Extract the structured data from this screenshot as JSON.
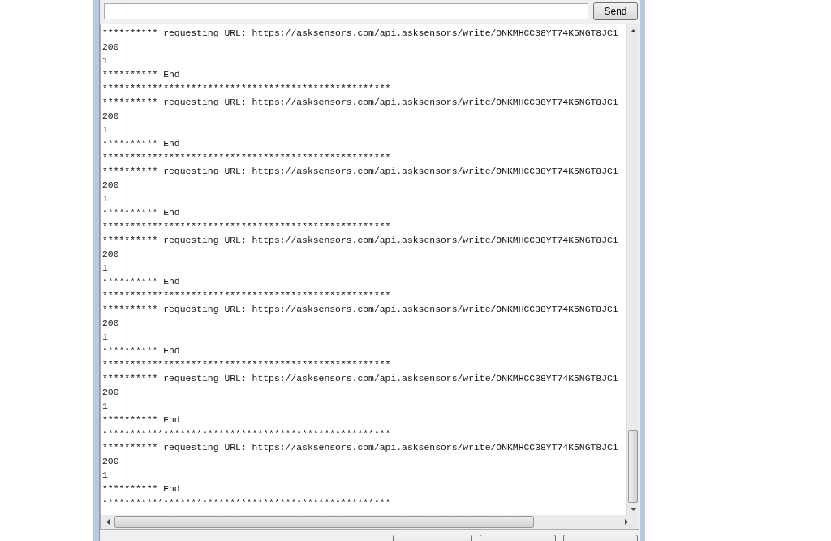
{
  "send_button": {
    "label": "Send"
  },
  "output_lines": [
    "********** requesting URL: https://asksensors.com/api.asksensors/write/ONKMHCC38YT74K5NGT8JC1",
    "200",
    "1",
    "********** End",
    "****************************************************",
    "********** requesting URL: https://asksensors.com/api.asksensors/write/ONKMHCC38YT74K5NGT8JC1",
    "200",
    "1",
    "********** End",
    "****************************************************",
    "********** requesting URL: https://asksensors.com/api.asksensors/write/ONKMHCC38YT74K5NGT8JC1",
    "200",
    "1",
    "********** End",
    "****************************************************",
    "********** requesting URL: https://asksensors.com/api.asksensors/write/ONKMHCC38YT74K5NGT8JC1",
    "200",
    "1",
    "********** End",
    "****************************************************",
    "********** requesting URL: https://asksensors.com/api.asksensors/write/ONKMHCC38YT74K5NGT8JC1",
    "200",
    "1",
    "********** End",
    "****************************************************",
    "********** requesting URL: https://asksensors.com/api.asksensors/write/ONKMHCC38YT74K5NGT8JC1",
    "200",
    "1",
    "********** End",
    "****************************************************",
    "********** requesting URL: https://asksensors.com/api.asksensors/write/ONKMHCC38YT74K5NGT8JC1",
    "200",
    "1",
    "********** End",
    "****************************************************"
  ]
}
